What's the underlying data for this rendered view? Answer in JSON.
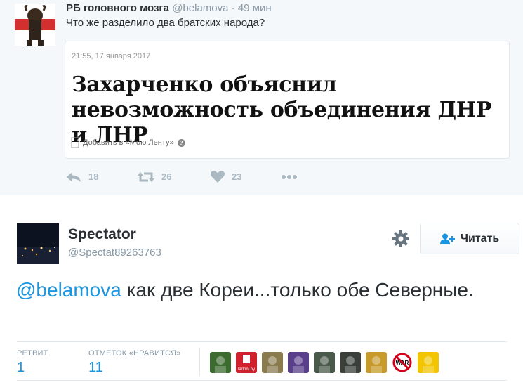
{
  "parent_tweet": {
    "author_name": "РБ головного мозга",
    "author_handle": "@belamova",
    "separator": "·",
    "time": "49 мин",
    "text": "Что же разделило два братских народа?",
    "card": {
      "date": "21:55, 17 января 2017",
      "title": "Захарченко объяснил невозможность объединения ДНР и ЛНР",
      "add_label": "Добавить в «Мою Ленту»",
      "help_glyph": "?"
    },
    "actions": {
      "reply_count": "18",
      "retweet_count": "26",
      "like_count": "23"
    }
  },
  "main_tweet": {
    "author_name": "Spectator",
    "author_handle": "@Spectat89263763",
    "follow_label": "Читать",
    "mention": "@belamova",
    "text": " как две Кореи...только обе Северные.",
    "stats": {
      "retweets_label": "РЕТВИТ",
      "retweets_value": "1",
      "likes_label": "ОТМЕТОК «НРАВИТСЯ»",
      "likes_value": "11"
    },
    "liker_avatars": [
      {
        "name": "liker-avatar-1",
        "bg": "#3b6b2f"
      },
      {
        "name": "liker-avatar-2",
        "bg": "#d0212d",
        "text": "ladoni.by"
      },
      {
        "name": "liker-avatar-3",
        "bg": "#8a7b4f"
      },
      {
        "name": "liker-avatar-4",
        "bg": "#5a3f8a"
      },
      {
        "name": "liker-avatar-5",
        "bg": "#4a5a4a"
      },
      {
        "name": "liker-avatar-6",
        "bg": "#3a3f3a"
      },
      {
        "name": "liker-avatar-7",
        "bg": "#c79a2a"
      },
      {
        "name": "liker-avatar-8",
        "bg": "#ffffff",
        "text": "WAR"
      },
      {
        "name": "liker-avatar-9",
        "bg": "#f2c500"
      }
    ]
  },
  "colors": {
    "link": "#1b95e0",
    "muted": "#8899a6",
    "icon": "#aab8c2",
    "parent_bg": "#f5f8fa"
  }
}
